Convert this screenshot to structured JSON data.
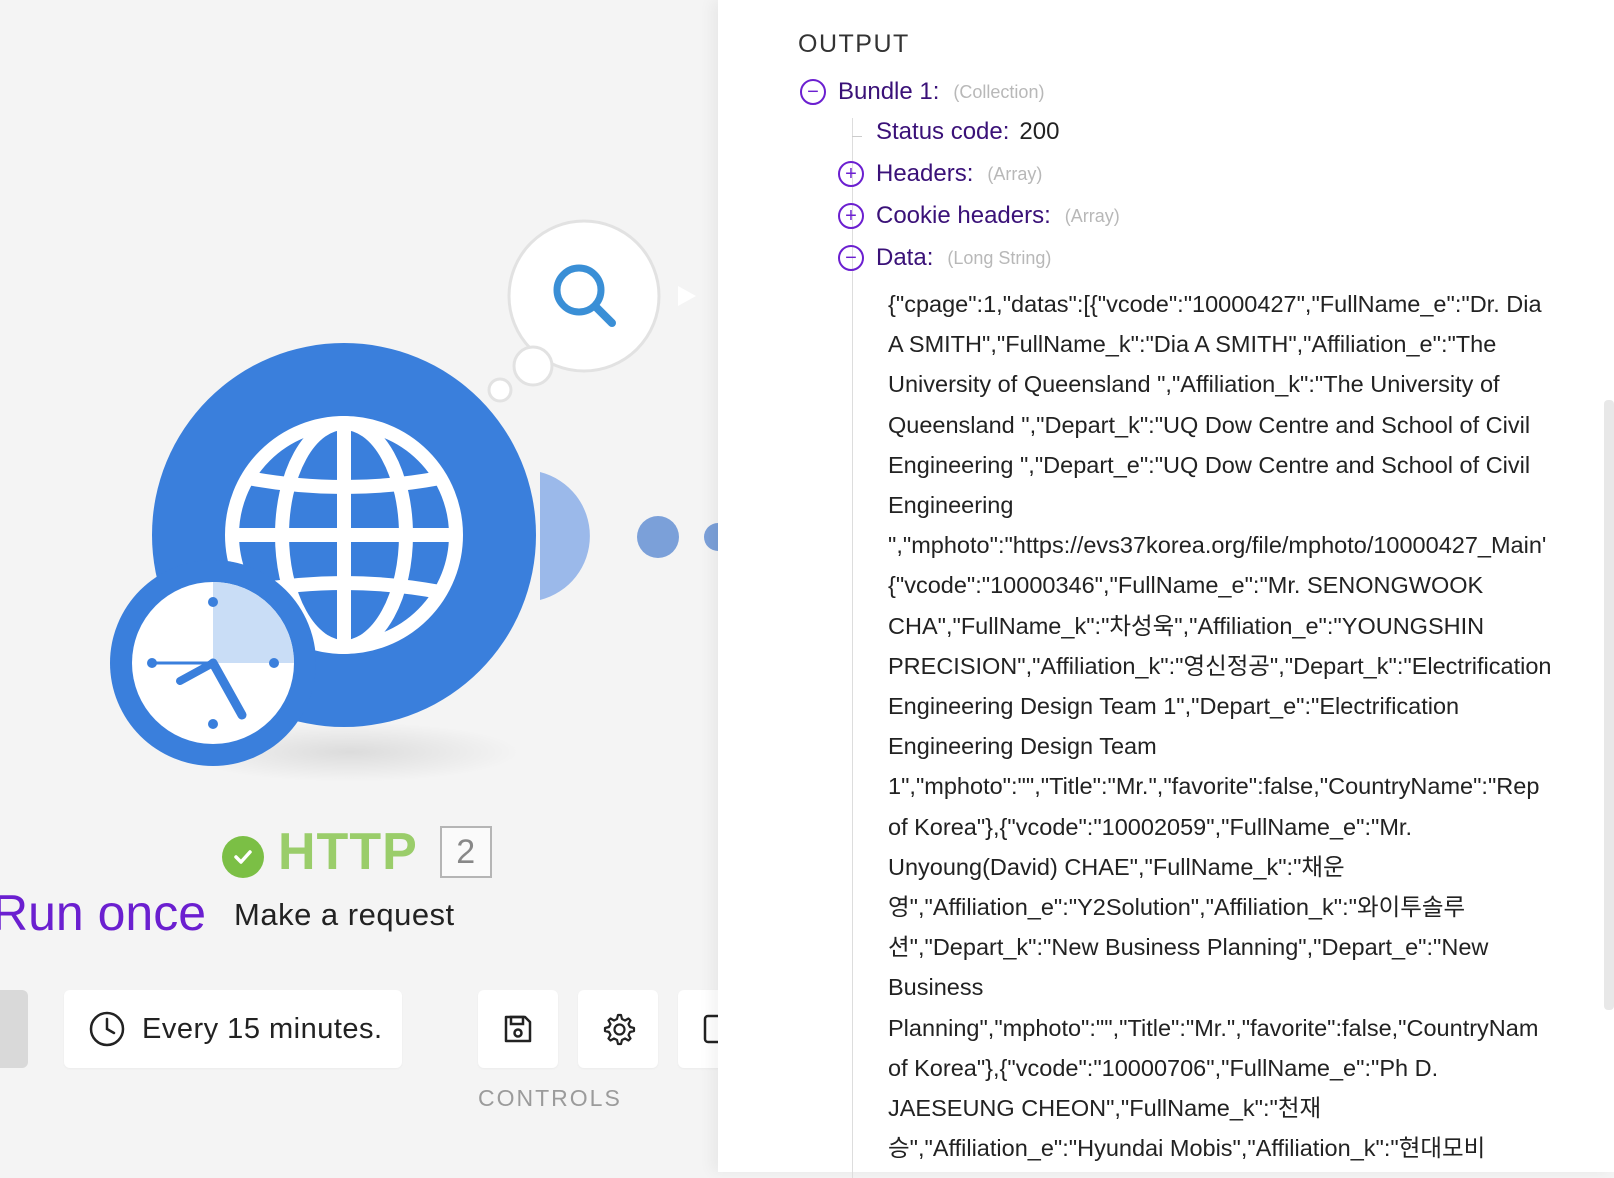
{
  "canvas": {
    "run_once_label": "Run once",
    "module": {
      "name": "HTTP",
      "id": "2",
      "action": "Make a request",
      "status": "success"
    },
    "schedule_label": "Every 15 minutes.",
    "controls_label": "CONTROLS",
    "icons": [
      "globe-icon",
      "clock-icon",
      "search-icon",
      "check-icon",
      "save-icon",
      "gear-icon"
    ]
  },
  "output": {
    "section_title": "OUTPUT",
    "bundle": {
      "key": "Bundle 1:",
      "type": "(Collection)",
      "status_code_key": "Status code:",
      "status_code_value": "200",
      "headers_key": "Headers:",
      "headers_type": "(Array)",
      "cookie_headers_key": "Cookie headers:",
      "cookie_headers_type": "(Array)",
      "data_key": "Data:",
      "data_type": "(Long String)",
      "data_lines": [
        "{\"cpage\":1,\"datas\":[{\"vcode\":\"10000427\",\"FullName_e\":\"Dr. Dia",
        "A SMITH\",\"FullName_k\":\"Dia A SMITH\",\"Affiliation_e\":\"The",
        "University of Queensland \",\"Affiliation_k\":\"The University of",
        "Queensland \",\"Depart_k\":\"UQ Dow Centre and School of Civil",
        "Engineering \",\"Depart_e\":\"UQ Dow Centre and School of Civil",
        "Engineering",
        "\",\"mphoto\":\"https://evs37korea.org/file/mphoto/10000427_Main'",
        "{\"vcode\":\"10000346\",\"FullName_e\":\"Mr. SENONGWOOK",
        "CHA\",\"FullName_k\":\"차성욱\",\"Affiliation_e\":\"YOUNGSHIN",
        "PRECISION\",\"Affiliation_k\":\"영신정공\",\"Depart_k\":\"Electrification",
        "Engineering Design Team 1\",\"Depart_e\":\"Electrification",
        "Engineering Design Team",
        "1\",\"mphoto\":\"\",\"Title\":\"Mr.\",\"favorite\":false,\"CountryName\":\"Rep",
        "of Korea\"},{\"vcode\":\"10002059\",\"FullName_e\":\"Mr.",
        "Unyoung(David) CHAE\",\"FullName_k\":\"채운",
        "영\",\"Affiliation_e\":\"Y2Solution\",\"Affiliation_k\":\"와이투솔루",
        "션\",\"Depart_k\":\"New Business Planning\",\"Depart_e\":\"New",
        "Business",
        "Planning\",\"mphoto\":\"\",\"Title\":\"Mr.\",\"favorite\":false,\"CountryNam",
        "of Korea\"},{\"vcode\":\"10000706\",\"FullName_e\":\"Ph D.",
        "JAESEUNG CHEON\",\"FullName_k\":\"천재",
        "승\",\"Affiliation_e\":\"Hyundai Mobis\",\"Affiliation_k\":\"현대모비"
      ]
    }
  }
}
